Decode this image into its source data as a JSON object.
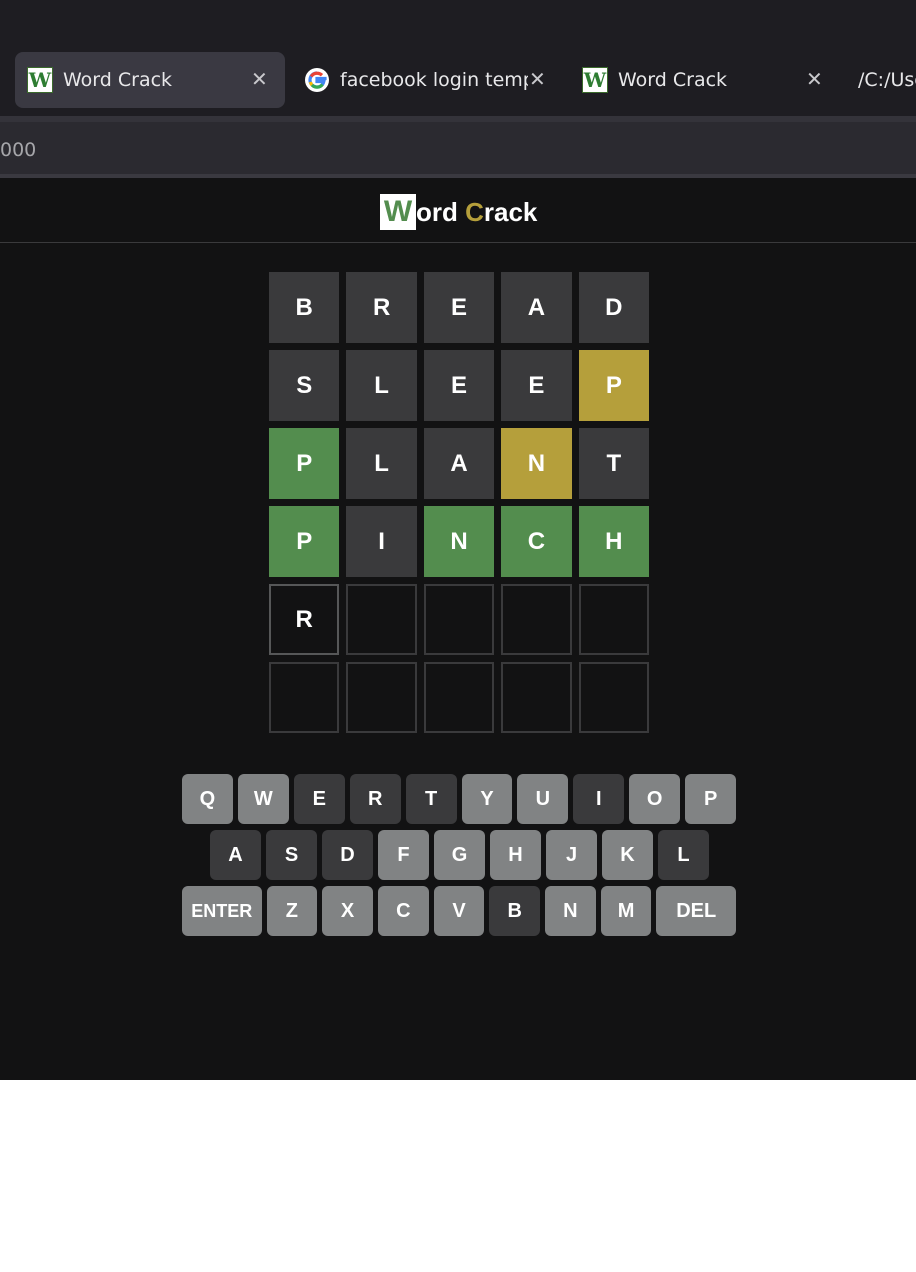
{
  "browser": {
    "tabs": [
      {
        "title": "Word Crack",
        "icon": "word-crack-favicon",
        "active": true
      },
      {
        "title": "facebook login templa",
        "icon": "google-favicon",
        "active": false
      },
      {
        "title": "Word Crack",
        "icon": "word-crack-favicon",
        "active": false
      },
      {
        "title": "/C:/Use",
        "icon": "",
        "active": false
      }
    ],
    "url": "000"
  },
  "app": {
    "title_first": "W",
    "title_mid": "ord ",
    "title_c": "C",
    "title_rest": "rack",
    "colors": {
      "green": "#538d4e",
      "yellow": "#b59f3b",
      "gray": "#3a3a3c",
      "key": "#818384",
      "background": "#121213"
    }
  },
  "board": {
    "rows": [
      [
        {
          "l": "B",
          "s": "gray"
        },
        {
          "l": "R",
          "s": "gray"
        },
        {
          "l": "E",
          "s": "gray"
        },
        {
          "l": "A",
          "s": "gray"
        },
        {
          "l": "D",
          "s": "gray"
        }
      ],
      [
        {
          "l": "S",
          "s": "gray"
        },
        {
          "l": "L",
          "s": "gray"
        },
        {
          "l": "E",
          "s": "gray"
        },
        {
          "l": "E",
          "s": "gray"
        },
        {
          "l": "P",
          "s": "yellow"
        }
      ],
      [
        {
          "l": "P",
          "s": "green"
        },
        {
          "l": "L",
          "s": "gray"
        },
        {
          "l": "A",
          "s": "gray"
        },
        {
          "l": "N",
          "s": "yellow"
        },
        {
          "l": "T",
          "s": "gray"
        }
      ],
      [
        {
          "l": "P",
          "s": "green"
        },
        {
          "l": "I",
          "s": "gray"
        },
        {
          "l": "N",
          "s": "green"
        },
        {
          "l": "C",
          "s": "green"
        },
        {
          "l": "H",
          "s": "green"
        }
      ],
      [
        {
          "l": "R",
          "s": "filled"
        },
        {
          "l": "",
          "s": "empty"
        },
        {
          "l": "",
          "s": "empty"
        },
        {
          "l": "",
          "s": "empty"
        },
        {
          "l": "",
          "s": "empty"
        }
      ],
      [
        {
          "l": "",
          "s": "empty"
        },
        {
          "l": "",
          "s": "empty"
        },
        {
          "l": "",
          "s": "empty"
        },
        {
          "l": "",
          "s": "empty"
        },
        {
          "l": "",
          "s": "empty"
        }
      ]
    ]
  },
  "keyboard": {
    "rows": [
      [
        {
          "k": "Q"
        },
        {
          "k": "W"
        },
        {
          "k": "E",
          "s": "absent"
        },
        {
          "k": "R",
          "s": "absent"
        },
        {
          "k": "T",
          "s": "absent"
        },
        {
          "k": "Y"
        },
        {
          "k": "U"
        },
        {
          "k": "I",
          "s": "absent"
        },
        {
          "k": "O"
        },
        {
          "k": "P"
        }
      ],
      [
        {
          "k": "A",
          "s": "absent"
        },
        {
          "k": "S",
          "s": "absent"
        },
        {
          "k": "D",
          "s": "absent"
        },
        {
          "k": "F"
        },
        {
          "k": "G"
        },
        {
          "k": "H"
        },
        {
          "k": "J"
        },
        {
          "k": "K"
        },
        {
          "k": "L",
          "s": "absent"
        }
      ],
      [
        {
          "k": "ENTER",
          "w": "wide"
        },
        {
          "k": "Z"
        },
        {
          "k": "X"
        },
        {
          "k": "C"
        },
        {
          "k": "V"
        },
        {
          "k": "B",
          "s": "absent"
        },
        {
          "k": "N"
        },
        {
          "k": "M"
        },
        {
          "k": "DEL",
          "w": "wide"
        }
      ]
    ]
  }
}
